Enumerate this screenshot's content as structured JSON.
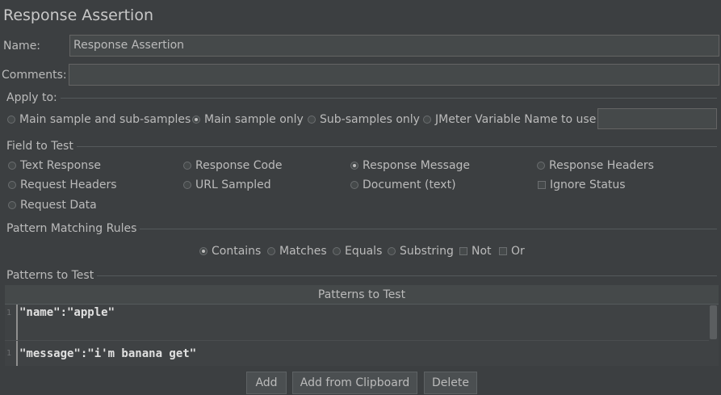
{
  "title": "Response Assertion",
  "name": {
    "label": "Name:",
    "value": "Response Assertion"
  },
  "comments": {
    "label": "Comments:",
    "value": ""
  },
  "apply_to": {
    "label": "Apply to:",
    "options": [
      {
        "label": "Main sample and sub-samples",
        "selected": false
      },
      {
        "label": "Main sample only",
        "selected": true
      },
      {
        "label": "Sub-samples only",
        "selected": false
      },
      {
        "label": "JMeter Variable Name to use",
        "selected": false
      }
    ],
    "variable_value": ""
  },
  "field_to_test": {
    "label": "Field to Test",
    "options": [
      {
        "label": "Text Response",
        "selected": false
      },
      {
        "label": "Response Code",
        "selected": false
      },
      {
        "label": "Response Message",
        "selected": true
      },
      {
        "label": "Response Headers",
        "selected": false
      },
      {
        "label": "Request Headers",
        "selected": false
      },
      {
        "label": "URL Sampled",
        "selected": false
      },
      {
        "label": "Document (text)",
        "selected": false
      },
      {
        "label": "Request Data",
        "selected": false
      }
    ],
    "ignore_status": {
      "label": "Ignore Status",
      "checked": false
    }
  },
  "pattern_matching": {
    "label": "Pattern Matching Rules",
    "options": [
      {
        "label": "Contains",
        "selected": true
      },
      {
        "label": "Matches",
        "selected": false
      },
      {
        "label": "Equals",
        "selected": false
      },
      {
        "label": "Substring",
        "selected": false
      }
    ],
    "not": {
      "label": "Not",
      "checked": false
    },
    "or": {
      "label": "Or",
      "checked": false
    }
  },
  "patterns": {
    "label": "Patterns to Test",
    "column_header": "Patterns to Test",
    "rows": [
      {
        "line": "1",
        "text": "\"name\":\"apple\""
      },
      {
        "line": "1",
        "text": "\"message\":\"i'm banana get\""
      }
    ]
  },
  "buttons": {
    "add": "Add",
    "add_from_clipboard": "Add from Clipboard",
    "delete": "Delete"
  }
}
